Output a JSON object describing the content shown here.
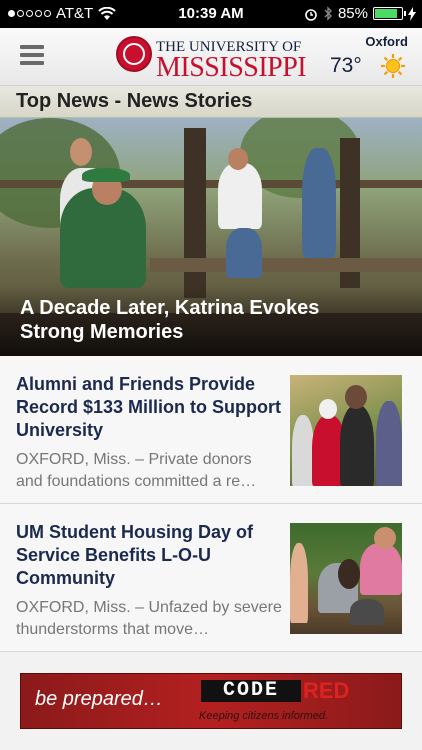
{
  "status_bar": {
    "carrier": "AT&T",
    "time": "10:39 AM",
    "battery": "85%",
    "battery_level": 0.85
  },
  "header": {
    "logo_line1": "THE UNIVERSITY OF",
    "logo_line2": "MISSISSIPPI",
    "weather": {
      "city": "Oxford",
      "temp": "73°",
      "icon": "sun-icon"
    }
  },
  "section": {
    "title": "Top News - News Stories"
  },
  "hero": {
    "title": "A Decade Later, Katrina Evokes Strong Memories"
  },
  "articles": [
    {
      "headline": "Alumni and Friends Provide Record $133 Million to Support University",
      "summary": "OXFORD, Miss. – Private donors and foundations committed a re…"
    },
    {
      "headline": "UM Student Housing Day of Service Benefits L-O-U Community",
      "summary": "OXFORD, Miss. – Unfazed by severe thunderstorms that move…"
    }
  ],
  "banner": {
    "text": "be prepared…",
    "brand_code": "CODE",
    "brand_red": "RED",
    "tagline": "Keeping citizens informed."
  },
  "colors": {
    "brand_red": "#c8102e",
    "navy": "#14213d",
    "battery_green": "#4cd964"
  }
}
